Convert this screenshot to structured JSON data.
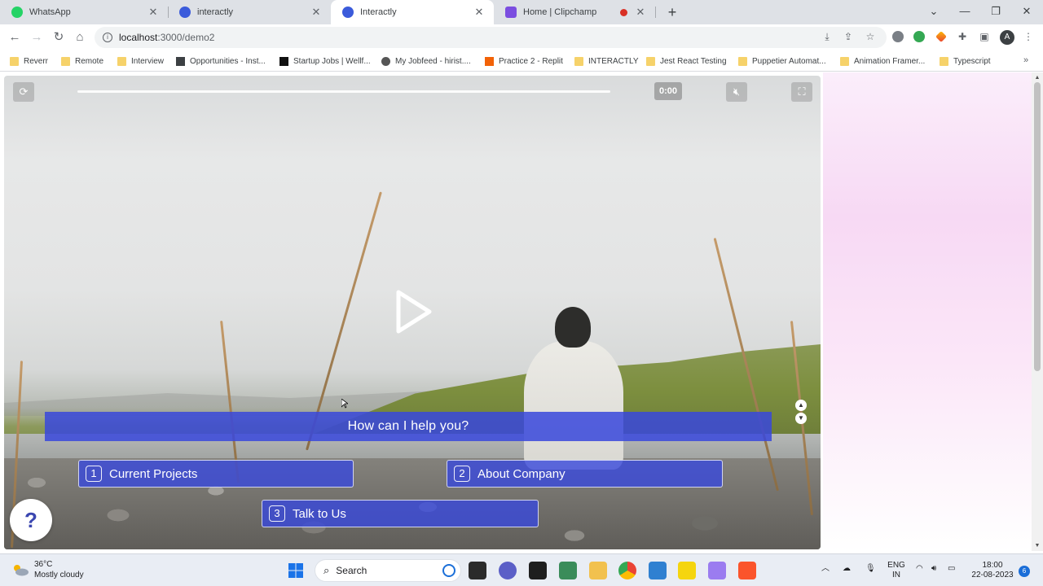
{
  "browser": {
    "tabs": [
      {
        "label": "WhatsApp",
        "favicon_color": "#25d366"
      },
      {
        "label": "interactly",
        "favicon_color": "#3b5bdb"
      },
      {
        "label": "Interactly",
        "favicon_color": "#3b5bdb"
      },
      {
        "label": "Home | Clipchamp",
        "favicon_color": "#7b4ee0"
      }
    ],
    "url_host": "localhost",
    "url_path": ":3000/demo2"
  },
  "bookmarks": [
    {
      "label": "Reverr",
      "icon": "folder-icon"
    },
    {
      "label": "Remote",
      "icon": "folder-icon"
    },
    {
      "label": "Interview",
      "icon": "folder-icon"
    },
    {
      "label": "Opportunities - Inst...",
      "icon": "ih-icon"
    },
    {
      "label": "Startup Jobs | Wellf...",
      "icon": "wellfound-icon"
    },
    {
      "label": "My Jobfeed - hirist....",
      "icon": "hirist-icon"
    },
    {
      "label": "Practice 2 - Replit",
      "icon": "replit-icon"
    },
    {
      "label": "INTERACTLY",
      "icon": "folder-icon"
    },
    {
      "label": "Jest React Testing",
      "icon": "folder-icon"
    },
    {
      "label": "Puppetier Automat...",
      "icon": "folder-icon"
    },
    {
      "label": "Animation Framer...",
      "icon": "folder-icon"
    },
    {
      "label": "Typescript",
      "icon": "folder-icon"
    }
  ],
  "player": {
    "time": "0:00",
    "progress_fraction": 0.0,
    "question": "How can I help you?",
    "options": [
      {
        "num": "1",
        "label": "Current Projects"
      },
      {
        "num": "2",
        "label": "About Company"
      },
      {
        "num": "3",
        "label": "Talk to Us"
      }
    ],
    "help_label": "?"
  },
  "taskbar": {
    "temperature": "36°C",
    "weather": "Mostly cloudy",
    "search_label": "Search",
    "lang_1": "ENG",
    "lang_2": "IN",
    "time": "18:00",
    "date": "22-08-2023",
    "notifications": "6"
  },
  "colors": {
    "accent": "#3848dc",
    "page_gradient": "#f7d9f4"
  }
}
